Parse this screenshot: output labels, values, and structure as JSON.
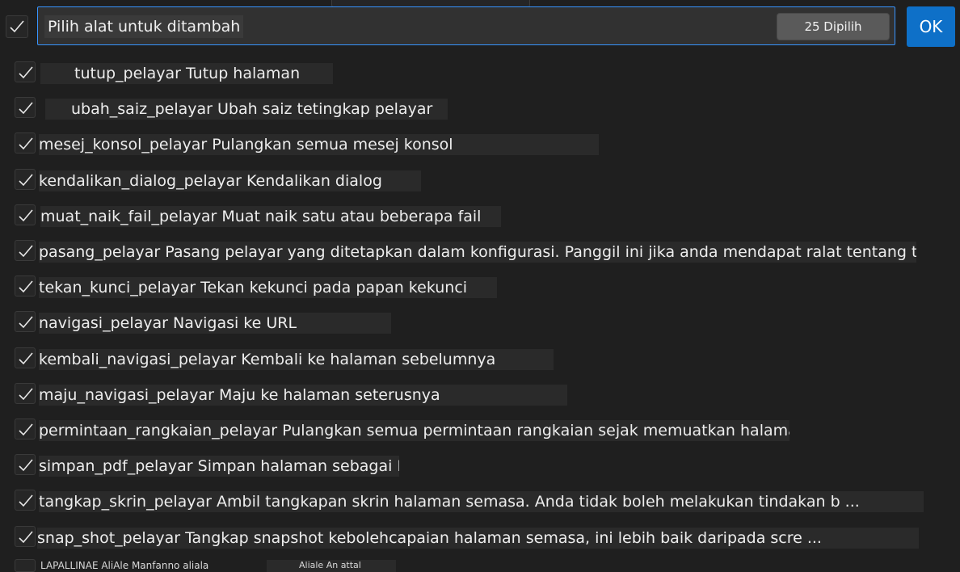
{
  "header": {
    "search_value": "Pilih alat untuk ditambah",
    "selected_count": "25 Dipilih",
    "ok_label": "OK"
  },
  "tools": [
    {
      "label": "tutup_pelayar Tutup halaman"
    },
    {
      "label": "ubah_saiz_pelayar Ubah saiz tetingkap pelayar"
    },
    {
      "label": "mesej_konsol_pelayar Pulangkan semua mesej konsol"
    },
    {
      "label": "kendalikan_dialog_pelayar Kendalikan dialog"
    },
    {
      "label": "muat_naik_fail_pelayar Muat naik satu atau beberapa fail"
    },
    {
      "label": "pasang_pelayar Pasang pelayar yang ditetapkan dalam konfigurasi. Panggil ini jika anda mendapat ralat tentang th ..."
    },
    {
      "label": "tekan_kunci_pelayar Tekan kekunci pada papan kekunci"
    },
    {
      "label": "navigasi_pelayar Navigasi ke URL"
    },
    {
      "label": "kembali_navigasi_pelayar Kembali ke halaman sebelumnya"
    },
    {
      "label": "maju_navigasi_pelayar Maju ke halaman seterusnya"
    },
    {
      "label": "permintaan_rangkaian_pelayar Pulangkan semua permintaan rangkaian sejak memuatkan halaman"
    },
    {
      "label": "simpan_pdf_pelayar Simpan halaman sebagai PDF"
    },
    {
      "label": "tangkap_skrin_pelayar Ambil tangkapan skrin halaman semasa. Anda tidak boleh melakukan tindakan b ..."
    },
    {
      "label": "snap_shot_pelayar Tangkap snapshot kebolehcapaian halaman semasa, ini lebih baik daripada scre ..."
    }
  ],
  "partial_row": {
    "label_a": "LAPALLINAE AliAle Manfanno aliala",
    "label_b": "Aliale An attal"
  },
  "colors": {
    "background": "#1f1f1f",
    "accent": "#3794ff",
    "ok_button": "#0e70c8"
  }
}
